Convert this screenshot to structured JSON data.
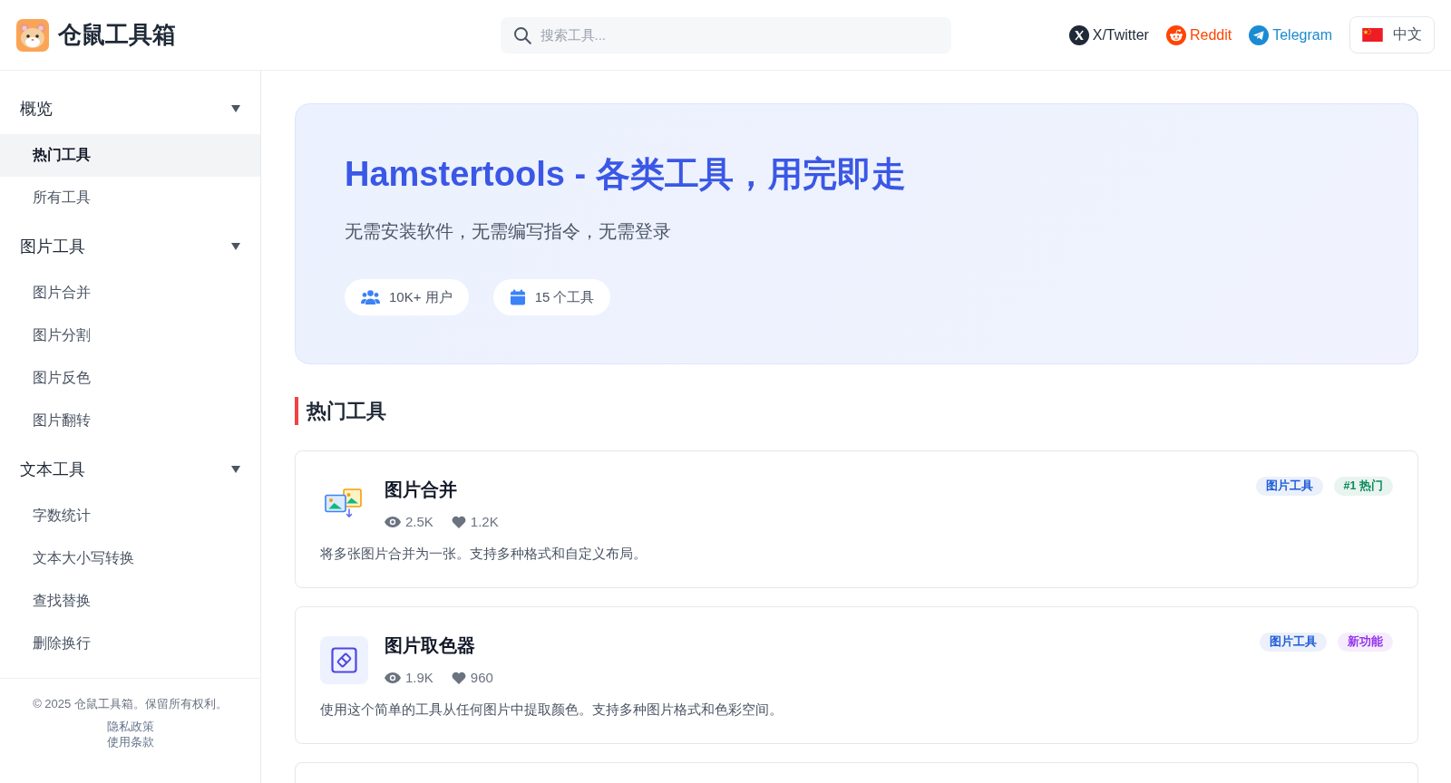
{
  "header": {
    "title": "仓鼠工具箱",
    "search": {
      "placeholder": "搜索工具..."
    },
    "social_links": [
      {
        "kind": "x",
        "label": "X/Twitter"
      },
      {
        "kind": "reddit",
        "label": "Reddit"
      },
      {
        "kind": "telegram",
        "label": "Telegram"
      }
    ],
    "language": {
      "label": "中文"
    }
  },
  "sidebar": {
    "groups": [
      {
        "title": "概览",
        "expanded": true,
        "items": [
          {
            "label": "热门工具",
            "selected": true
          },
          {
            "label": "所有工具",
            "selected": false
          }
        ]
      },
      {
        "title": "图片工具",
        "expanded": true,
        "items": [
          {
            "label": "图片合并",
            "selected": false
          },
          {
            "label": "图片分割",
            "selected": false
          },
          {
            "label": "图片反色",
            "selected": false
          },
          {
            "label": "图片翻转",
            "selected": false
          }
        ]
      },
      {
        "title": "文本工具",
        "expanded": true,
        "items": [
          {
            "label": "字数统计",
            "selected": false
          },
          {
            "label": "文本大小写转换",
            "selected": false
          },
          {
            "label": "查找替换",
            "selected": false
          },
          {
            "label": "删除换行",
            "selected": false
          }
        ]
      }
    ],
    "footer": {
      "copyright": "© 2025 仓鼠工具箱。保留所有权利。",
      "links": [
        "隐私政策",
        "使用条款"
      ]
    }
  },
  "hero": {
    "title": "Hamstertools - 各类工具，用完即走",
    "subtitle": "无需安装软件，无需编写指令，无需登录",
    "stats": [
      {
        "kind": "users",
        "label": "10K+ 用户"
      },
      {
        "kind": "tools",
        "label": "15 个工具"
      }
    ]
  },
  "section": {
    "title": "热门工具"
  },
  "tools": [
    {
      "kind": "merge",
      "title": "图片合并",
      "views": "2.5K",
      "likes": "1.2K",
      "description": "将多张图片合并为一张。支持多种格式和自定义布局。",
      "tags": [
        {
          "label": "图片工具",
          "color": "#1d5bd8"
        },
        {
          "label": "#1 热门",
          "color": "#0a8a5a"
        }
      ]
    },
    {
      "kind": "picker",
      "title": "图片取色器",
      "views": "1.9K",
      "likes": "960",
      "description": "使用这个简单的工具从任何图片中提取颜色。支持多种图片格式和色彩空间。",
      "tags": [
        {
          "label": "图片工具",
          "color": "#1d5bd8"
        },
        {
          "label": "新功能",
          "color": "#9333ea"
        }
      ]
    }
  ]
}
